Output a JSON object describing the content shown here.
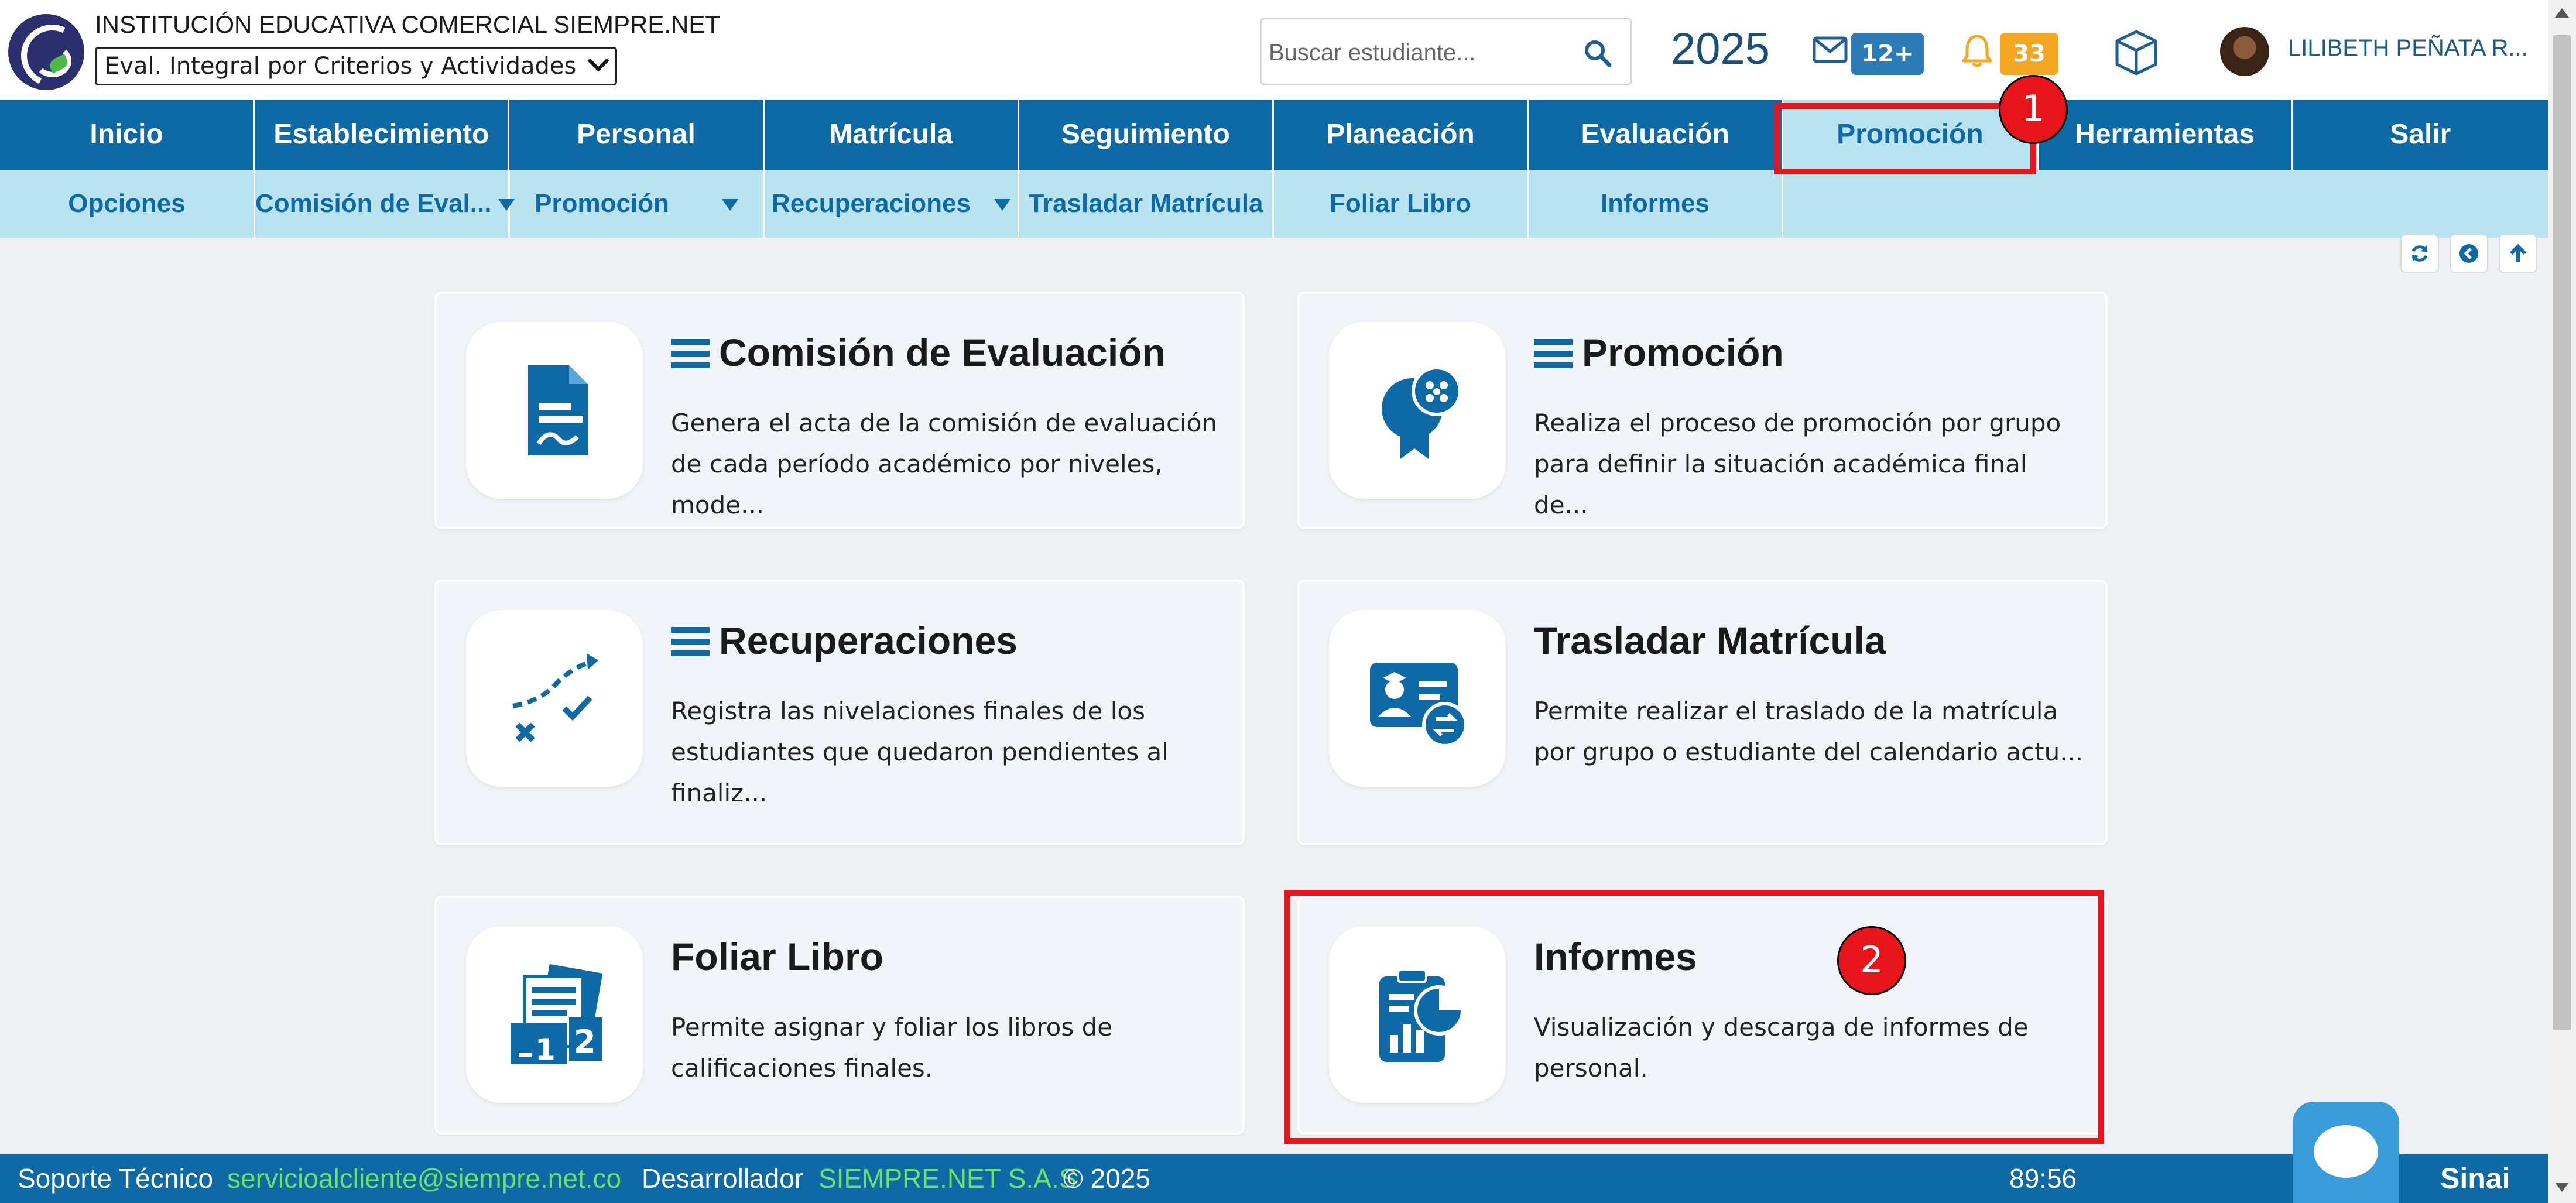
{
  "header": {
    "institution": "INSTITUCIÓN EDUCATIVA COMERCIAL SIEMPRE.NET",
    "eval_select": "Eval. Integral por Criterios y Actividades",
    "search_placeholder": "Buscar estudiante...",
    "year": "2025",
    "mail_badge": "12+",
    "notif_badge": "33",
    "user_name": "LILIBETH PEÑATA R..."
  },
  "main_nav": [
    "Inicio",
    "Establecimiento",
    "Personal",
    "Matrícula",
    "Seguimiento",
    "Planeación",
    "Evaluación",
    "Promoción",
    "Herramientas",
    "Salir"
  ],
  "sub_nav": {
    "opciones": "Opciones",
    "comision": "Comisión de Eval...",
    "promocion": "Promoción",
    "recuperaciones": "Recuperaciones",
    "trasladar": "Trasladar Matrícula",
    "foliar": "Foliar Libro",
    "informes": "Informes"
  },
  "cards": [
    {
      "title": "Comisión de Evaluación",
      "desc": "Genera el acta de la comisión de evaluación de cada período académico por niveles, mode...",
      "icon": "document-signature-icon"
    },
    {
      "title": "Promoción",
      "desc": "Realiza el proceso de promoción por grupo para definir la situación académica final de...",
      "icon": "award-ribbon-icon"
    },
    {
      "title": "Recuperaciones",
      "desc": "Registra las nivelaciones finales de los estudiantes que quedaron pendientes al finaliz...",
      "icon": "progress-path-icon"
    },
    {
      "title": "Trasladar Matrícula",
      "desc": "Permite realizar el traslado de la matrícula por grupo o estudiante del calendario actu...",
      "icon": "transfer-card-icon"
    },
    {
      "title": "Foliar Libro",
      "desc": "Permite asignar y foliar los libros de calificaciones finales.",
      "icon": "numbered-pages-icon"
    },
    {
      "title": "Informes",
      "desc": "Visualización y descarga de informes de personal.",
      "icon": "report-chart-icon"
    }
  ],
  "markers": [
    "1",
    "2"
  ],
  "footer": {
    "support_label": "Soporte Técnico",
    "support_email": "servicioalcliente@siempre.net.co",
    "dev_label": "Desarrollador",
    "dev_name": "SIEMPRE.NET S.A.S",
    "copyright": "© 2025",
    "timer": "89:56",
    "brand": "Sinai"
  },
  "colors": {
    "primary": "#0e6aa6",
    "subnav": "#b9e3ef",
    "highlight": "#e8141b",
    "badge_blue": "#2c7bb6",
    "badge_orange": "#f5a623"
  }
}
